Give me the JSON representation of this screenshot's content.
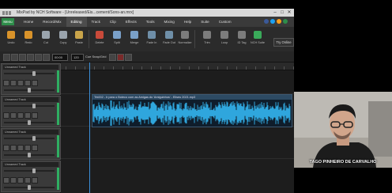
{
  "app": {
    "title": "MixPad by NCH Software - [Unreleased/Eis...cement/Sons-an.mrx]"
  },
  "menubar": {
    "menu_label": "Menu",
    "tabs": [
      "Home",
      "Record/Mix",
      "Editing",
      "Track",
      "Clip",
      "Effects",
      "Tools",
      "Mixing",
      "Help",
      "Suite",
      "Custom"
    ],
    "active_tab": "Editing"
  },
  "ribbon": {
    "buttons": [
      {
        "label": "Undo",
        "icon": "undo-icon",
        "color": "#d9932a"
      },
      {
        "label": "Redo",
        "icon": "redo-icon",
        "color": "#d9932a"
      },
      {
        "label": "Cut",
        "icon": "cut-icon",
        "color": "#9aa4ad"
      },
      {
        "label": "Copy",
        "icon": "copy-icon",
        "color": "#9aa4ad"
      },
      {
        "label": "Paste",
        "icon": "paste-icon",
        "color": "#c9a44a"
      },
      {
        "label": "Delete",
        "icon": "delete-icon",
        "color": "#c94a3a"
      },
      {
        "label": "Split",
        "icon": "split-icon",
        "color": "#7aa0c8"
      },
      {
        "label": "Merge",
        "icon": "merge-icon",
        "color": "#7aa0c8"
      },
      {
        "label": "Fade In",
        "icon": "fade-in-icon",
        "color": "#6f8fa8"
      },
      {
        "label": "Fade Out",
        "icon": "fade-out-icon",
        "color": "#6f8fa8"
      },
      {
        "label": "Normalize",
        "icon": "normalize-icon",
        "color": "#7c7c7c"
      },
      {
        "label": "Trim",
        "icon": "trim-icon",
        "color": "#7c7c7c"
      },
      {
        "label": "Loop",
        "icon": "loop-icon",
        "color": "#7c7c7c"
      },
      {
        "label": "ID Tag",
        "icon": "tag-icon",
        "color": "#7c7c7c"
      },
      {
        "label": "NCH Suite",
        "icon": "nch-suite-icon",
        "color": "#3aaa5a"
      }
    ],
    "try_online": "Try Online"
  },
  "timebar": {
    "time": "00:00",
    "snap_label": "Cue Snap/Grid",
    "bpm": "120"
  },
  "tracks": [
    {
      "name": "Unnamed Track"
    },
    {
      "name": "Unnamed Track"
    },
    {
      "name": "Unnamed Track"
    },
    {
      "name": "Unnamed Track"
    }
  ],
  "clip": {
    "label": "Trk002 - Ir para o Boteco com as Amigas do 'Amiguinhos' - Eliseu 2021.mp3"
  },
  "webcam": {
    "caption": "TAGO PINHEIRO DE CARVALHO"
  },
  "colors": {
    "accent": "#2e8d4a",
    "waveform": "#2fa6dd",
    "playhead": "#3c8fd8"
  }
}
